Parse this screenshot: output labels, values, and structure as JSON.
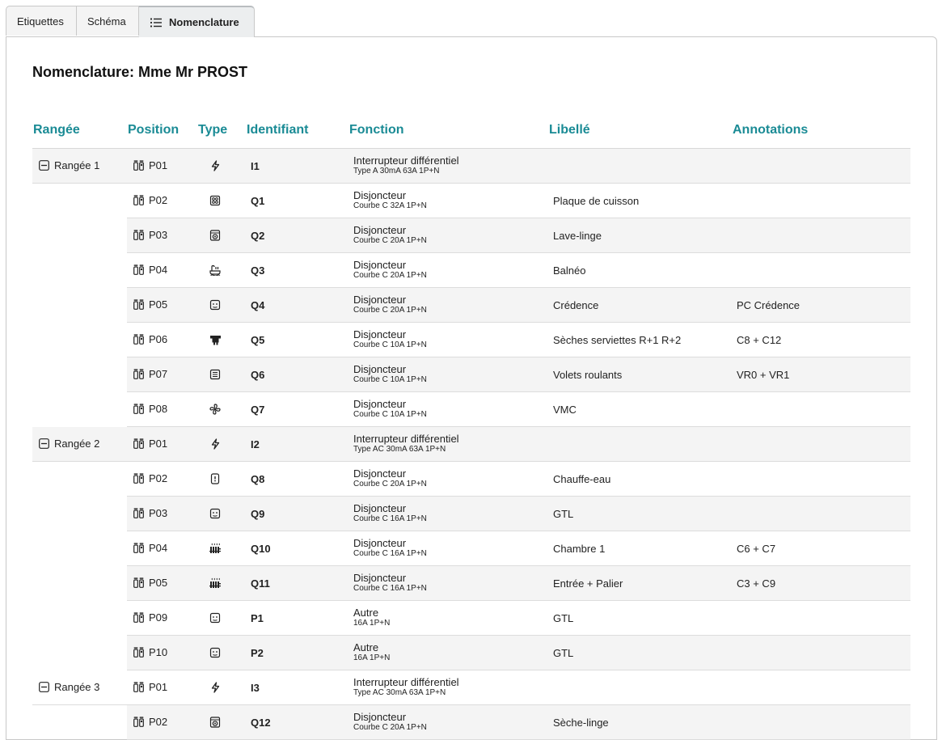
{
  "tabs": [
    {
      "label": "Etiquettes",
      "active": false
    },
    {
      "label": "Schéma",
      "active": false
    },
    {
      "label": "Nomenclature",
      "active": true,
      "icon": "list-icon"
    }
  ],
  "title": "Nomenclature: Mme Mr PROST",
  "columns": [
    "Rangée",
    "Position",
    "Type",
    "Identifiant",
    "Fonction",
    "Libellé",
    "Annotations"
  ],
  "accent_color": "#1a8b95",
  "rows": [
    {
      "rangee": "Rangée 1",
      "position": "P01",
      "type_icon": "lightning-icon",
      "id": "I1",
      "fonction": "Interrupteur différentiel",
      "detail": "Type A 30mA 63A 1P+N",
      "libelle": "",
      "annotation": ""
    },
    {
      "rangee": "",
      "position": "P02",
      "type_icon": "cooktop-icon",
      "id": "Q1",
      "fonction": "Disjoncteur",
      "detail": "Courbe C 32A 1P+N",
      "libelle": "Plaque de cuisson",
      "annotation": ""
    },
    {
      "rangee": "",
      "position": "P03",
      "type_icon": "washing-machine-icon",
      "id": "Q2",
      "fonction": "Disjoncteur",
      "detail": "Courbe C 20A 1P+N",
      "libelle": "Lave-linge",
      "annotation": ""
    },
    {
      "rangee": "",
      "position": "P04",
      "type_icon": "bath-icon",
      "id": "Q3",
      "fonction": "Disjoncteur",
      "detail": "Courbe C 20A 1P+N",
      "libelle": "Balnéo",
      "annotation": ""
    },
    {
      "rangee": "",
      "position": "P05",
      "type_icon": "socket-icon",
      "id": "Q4",
      "fonction": "Disjoncteur",
      "detail": "Courbe C 20A 1P+N",
      "libelle": "Crédence",
      "annotation": "PC Crédence"
    },
    {
      "rangee": "",
      "position": "P06",
      "type_icon": "towel-dryer-icon",
      "id": "Q5",
      "fonction": "Disjoncteur",
      "detail": "Courbe C 10A 1P+N",
      "libelle": "Sèches serviettes R+1 R+2",
      "annotation": "C8 + C12"
    },
    {
      "rangee": "",
      "position": "P07",
      "type_icon": "shutter-icon",
      "id": "Q6",
      "fonction": "Disjoncteur",
      "detail": "Courbe C 10A 1P+N",
      "libelle": "Volets roulants",
      "annotation": "VR0 + VR1"
    },
    {
      "rangee": "",
      "position": "P08",
      "type_icon": "fan-icon",
      "id": "Q7",
      "fonction": "Disjoncteur",
      "detail": "Courbe C 10A 1P+N",
      "libelle": "VMC",
      "annotation": ""
    },
    {
      "rangee": "Rangée 2",
      "position": "P01",
      "type_icon": "lightning-icon",
      "id": "I2",
      "fonction": "Interrupteur différentiel",
      "detail": "Type AC 30mA 63A 1P+N",
      "libelle": "",
      "annotation": ""
    },
    {
      "rangee": "",
      "position": "P02",
      "type_icon": "water-heater-icon",
      "id": "Q8",
      "fonction": "Disjoncteur",
      "detail": "Courbe C 20A 1P+N",
      "libelle": "Chauffe-eau",
      "annotation": ""
    },
    {
      "rangee": "",
      "position": "P03",
      "type_icon": "socket-icon",
      "id": "Q9",
      "fonction": "Disjoncteur",
      "detail": "Courbe C 16A 1P+N",
      "libelle": "GTL",
      "annotation": ""
    },
    {
      "rangee": "",
      "position": "P04",
      "type_icon": "radiator-icon",
      "id": "Q10",
      "fonction": "Disjoncteur",
      "detail": "Courbe C 16A 1P+N",
      "libelle": "Chambre 1",
      "annotation": "C6 + C7"
    },
    {
      "rangee": "",
      "position": "P05",
      "type_icon": "radiator-icon",
      "id": "Q11",
      "fonction": "Disjoncteur",
      "detail": "Courbe C 16A 1P+N",
      "libelle": "Entrée + Palier",
      "annotation": "C3 + C9"
    },
    {
      "rangee": "",
      "position": "P09",
      "type_icon": "socket-icon",
      "id": "P1",
      "fonction": "Autre",
      "detail": "16A 1P+N",
      "libelle": "GTL",
      "annotation": ""
    },
    {
      "rangee": "",
      "position": "P10",
      "type_icon": "socket-icon",
      "id": "P2",
      "fonction": "Autre",
      "detail": "16A 1P+N",
      "libelle": "GTL",
      "annotation": ""
    },
    {
      "rangee": "Rangée 3",
      "position": "P01",
      "type_icon": "lightning-icon",
      "id": "I3",
      "fonction": "Interrupteur différentiel",
      "detail": "Type AC 30mA 63A 1P+N",
      "libelle": "",
      "annotation": ""
    },
    {
      "rangee": "",
      "position": "P02",
      "type_icon": "washing-machine-icon",
      "id": "Q12",
      "fonction": "Disjoncteur",
      "detail": "Courbe C 20A 1P+N",
      "libelle": "Sèche-linge",
      "annotation": ""
    }
  ]
}
